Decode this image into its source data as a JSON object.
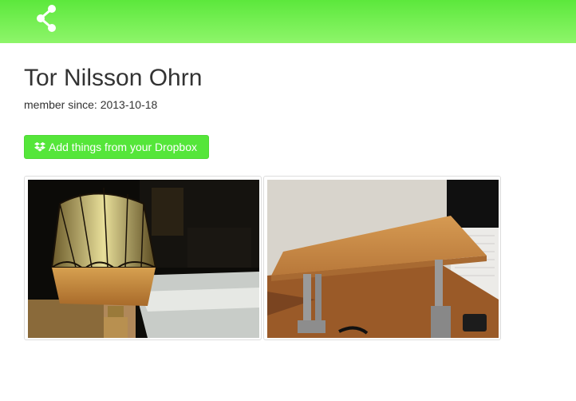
{
  "header": {
    "share_icon": "share-icon",
    "bar_color": "#6cee4c"
  },
  "profile": {
    "name": "Tor Nilsson Ohrn",
    "member_since": "member since: 2013-10-18"
  },
  "actions": {
    "add_dropbox_label": "Add things from your Dropbox",
    "add_dropbox_icon": "dropbox-icon",
    "button_color": "#55e63a"
  },
  "gallery": {
    "items": [
      {
        "subject": "lamp-photo"
      },
      {
        "subject": "desk-photo"
      }
    ]
  }
}
